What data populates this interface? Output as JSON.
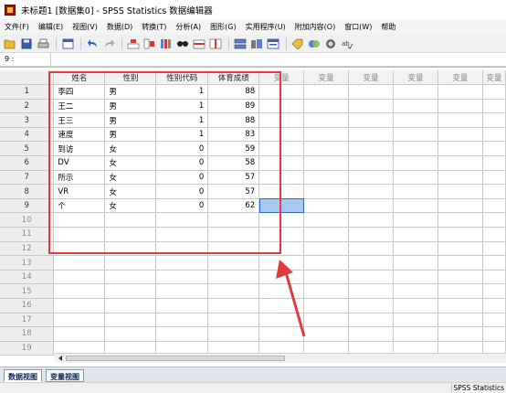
{
  "window": {
    "title": "未标题1 [数据集0] - SPSS Statistics 数据编辑器"
  },
  "menu": [
    "文件(F)",
    "编辑(E)",
    "视图(V)",
    "数据(D)",
    "转换(T)",
    "分析(A)",
    "图形(G)",
    "实用程序(U)",
    "附加内容(O)",
    "窗口(W)",
    "帮助"
  ],
  "toolbar": {
    "icons": [
      "open-folder-icon",
      "save-icon",
      "print-icon",
      "dialog-recall-icon",
      "undo-icon",
      "redo-icon",
      "goto-case-icon",
      "goto-variable-icon",
      "variables-icon",
      "find-icon",
      "insert-cases-icon",
      "insert-variable-icon",
      "split-file-icon",
      "weight-cases-icon",
      "select-cases-icon",
      "value-labels-icon",
      "use-sets-icon",
      "show-all-icon",
      "spelling-icon"
    ]
  },
  "cell_editor": {
    "reference": "9 :",
    "value": ""
  },
  "grid": {
    "columns": [
      "姓名",
      "性别",
      "性别代码",
      "体育成绩",
      "变量",
      "变量",
      "变量",
      "变量",
      "变量",
      "变量"
    ],
    "rows": [
      [
        "李四",
        "男",
        "1",
        "88"
      ],
      [
        "王二",
        "男",
        "1",
        "89"
      ],
      [
        "王三",
        "男",
        "1",
        "88"
      ],
      [
        "速度",
        "男",
        "1",
        "83"
      ],
      [
        "到访",
        "女",
        "0",
        "59"
      ],
      [
        "DV",
        "女",
        "0",
        "58"
      ],
      [
        "所示",
        "女",
        "0",
        "57"
      ],
      [
        "VR",
        "女",
        "0",
        "57"
      ],
      [
        "个",
        "女",
        "0",
        "62"
      ]
    ],
    "row_numbers": [
      "1",
      "2",
      "3",
      "4",
      "5",
      "6",
      "7",
      "8",
      "9",
      "10",
      "11",
      "12",
      "13",
      "14",
      "15",
      "16",
      "17",
      "18",
      "19"
    ],
    "selected_cell": {
      "row": "9",
      "column": "变量"
    }
  },
  "annotation": {
    "color": "#e13b3b"
  },
  "tabs": {
    "data_view": "数据视图",
    "variable_view": "变量视图"
  },
  "status": {
    "text": "SPSS Statistics"
  },
  "colors": {
    "selection": "#a9c8ef",
    "selection_border": "#2d68d8",
    "header_bg": "#f2f2f2"
  }
}
